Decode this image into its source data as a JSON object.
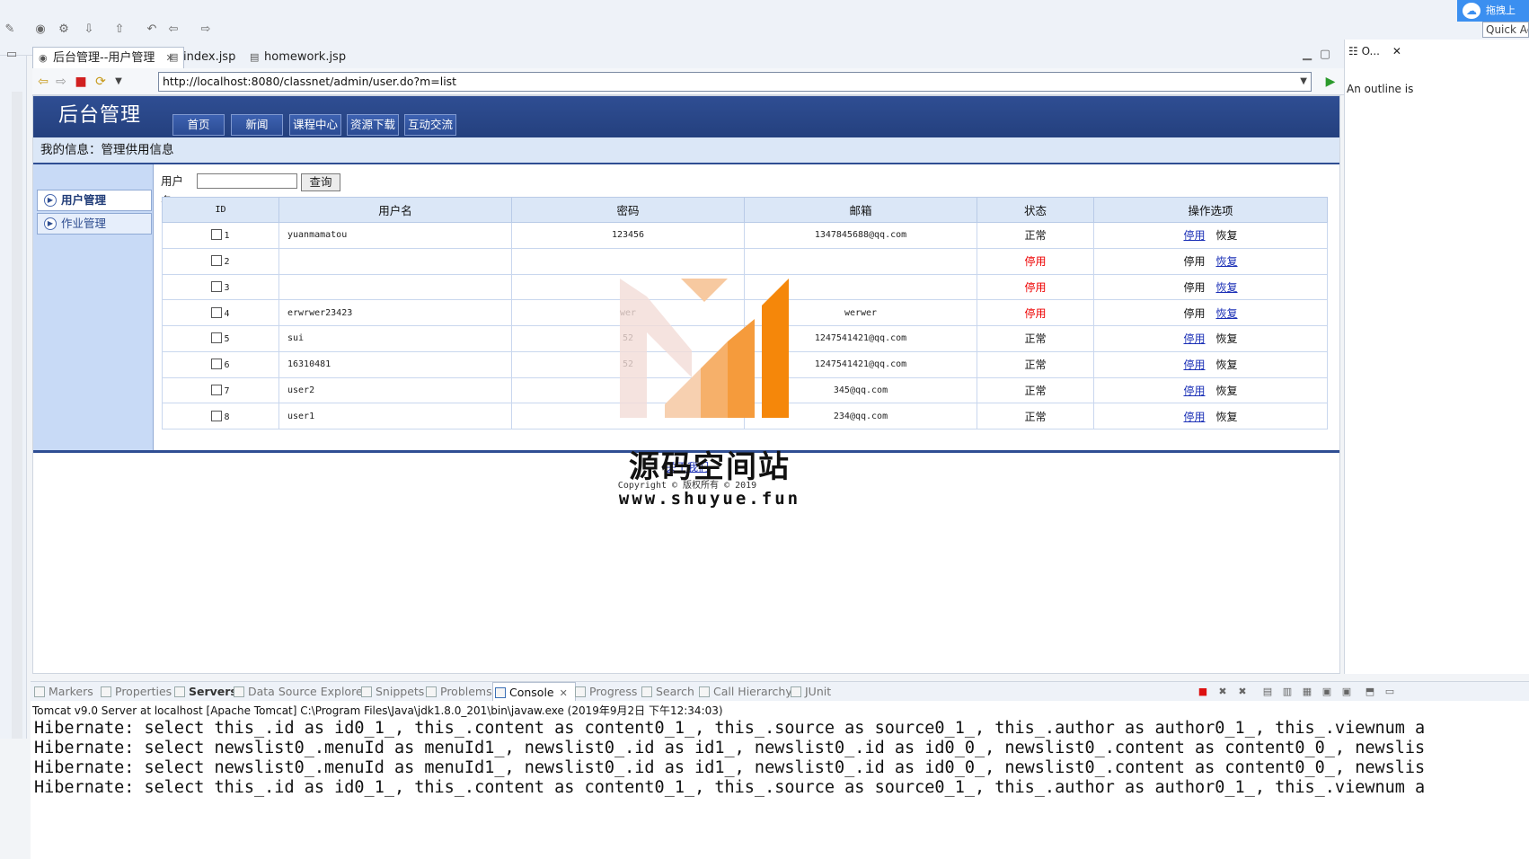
{
  "editor_tabs": [
    {
      "label": "后台管理--用户管理",
      "active": true
    },
    {
      "label": "index.jsp",
      "active": false
    },
    {
      "label": "homework.jsp",
      "active": false
    }
  ],
  "browser": {
    "url": "http://localhost:8080/classnet/admin/user.do?m=list"
  },
  "toolbar": {
    "quick_access": "Quick Ac",
    "cloud_label": "拖拽上"
  },
  "site": {
    "title": "后台管理",
    "nav": [
      "首页",
      "新闻",
      "课程中心",
      "资源下载",
      "互动交流"
    ],
    "info": "我的信息：管理供用信息",
    "sidebar": [
      "用户管理",
      "作业管理"
    ],
    "search_label": "用户名:",
    "search_button": "查询",
    "table": {
      "headers": [
        "ID",
        "用户名",
        "密码",
        "邮箱",
        "状态",
        "操作选项"
      ],
      "rows": [
        {
          "id": "1",
          "username": "yuanmamatou",
          "password": "123456",
          "email": "1347845688@qq.com",
          "status": "正常",
          "op1": "停用",
          "op2": "恢复"
        },
        {
          "id": "2",
          "username": "",
          "password": "",
          "email": "",
          "status": "停用",
          "op1": "停用",
          "op2": "恢复"
        },
        {
          "id": "3",
          "username": "",
          "password": "",
          "email": "",
          "status": "停用",
          "op1": "停用",
          "op2": "恢复"
        },
        {
          "id": "4",
          "username": "erwrwer23423",
          "password": "wer",
          "email": "werwer",
          "status": "停用",
          "op1": "停用",
          "op2": "恢复"
        },
        {
          "id": "5",
          "username": "sui",
          "password": "52",
          "email": "1247541421@qq.com",
          "status": "正常",
          "op1": "停用",
          "op2": "恢复"
        },
        {
          "id": "6",
          "username": "16310481",
          "password": "52",
          "email": "1247541421@qq.com",
          "status": "正常",
          "op1": "停用",
          "op2": "恢复"
        },
        {
          "id": "7",
          "username": "user2",
          "password": "",
          "email": "345@qq.com",
          "status": "正常",
          "op1": "停用",
          "op2": "恢复"
        },
        {
          "id": "8",
          "username": "user1",
          "password": "",
          "email": "234@qq.com",
          "status": "正常",
          "op1": "停用",
          "op2": "恢复"
        }
      ]
    },
    "footer_link": "关于我们",
    "copyright": "Copyright © 版权所有 © 2019"
  },
  "watermark": {
    "title": "源码空间站",
    "url": "www.shuyue.fun"
  },
  "outline": {
    "tab": "O...",
    "message": "An outline is"
  },
  "bottom_tabs": [
    "Markers",
    "Properties",
    "Servers",
    "Data Source Explorer",
    "Snippets",
    "Problems",
    "Console",
    "Progress",
    "Search",
    "Call Hierarchy",
    "JUnit"
  ],
  "console": {
    "server": "Tomcat v9.0 Server at localhost [Apache Tomcat] C:\\Program Files\\Java\\jdk1.8.0_201\\bin\\javaw.exe (2019年9月2日 下午12:34:03)",
    "lines": [
      "Hibernate: select this_.id as id0_1_, this_.content as content0_1_, this_.source as source0_1_, this_.author as author0_1_, this_.viewnum a",
      "Hibernate: select newslist0_.menuId as menuId1_, newslist0_.id as id1_, newslist0_.id as id0_0_, newslist0_.content as content0_0_, newslis",
      "Hibernate: select newslist0_.menuId as menuId1_, newslist0_.id as id1_, newslist0_.id as id0_0_, newslist0_.content as content0_0_, newslis",
      "Hibernate: select this_.id as id0_1_, this_.content as content0_1_, this_.source as source0_1_, this_.author as author0_1_, this_.viewnum a"
    ]
  },
  "colors": {
    "header_blue": "#2f4e93",
    "status_disabled": "#ee0000",
    "link_blue": "#1a2fb6",
    "watermark_orange": "#f5870a"
  }
}
